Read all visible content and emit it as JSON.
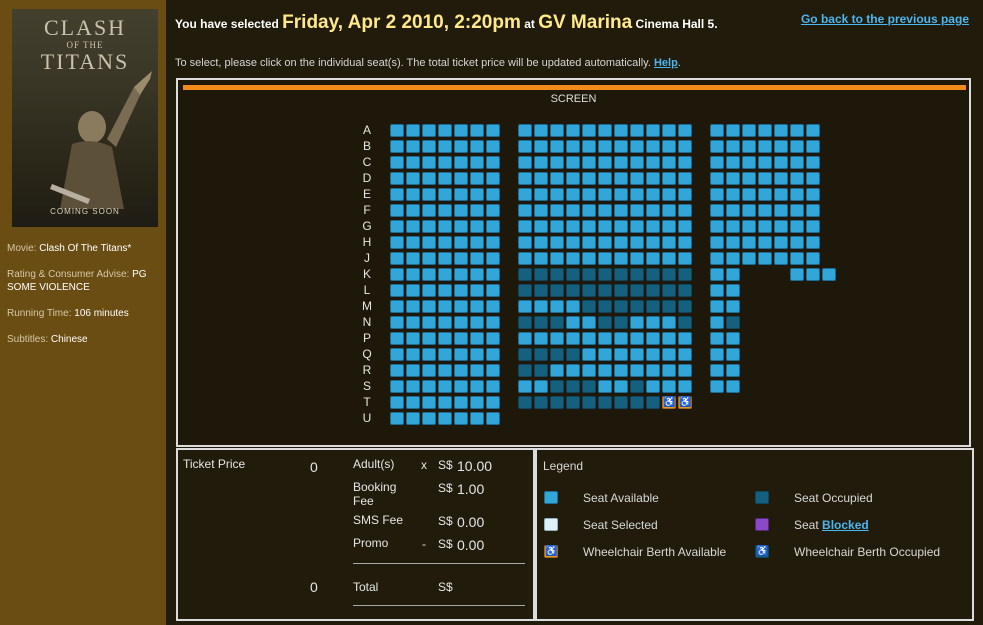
{
  "sidebar": {
    "poster": {
      "title_line1": "CLASH",
      "title_line2": "OF THE",
      "title_line3": "TITANS",
      "caption": "COMING SOON"
    },
    "movie_label": "Movie:",
    "movie_value": "Clash Of The Titans*",
    "rating_label": "Rating & Consumer Advise:",
    "rating_value": "PG",
    "rating_advice": "SOME VIOLENCE",
    "runtime_label": "Running Time:",
    "runtime_value": "106 minutes",
    "subtitles_label": "Subtitles:",
    "subtitles_value": "Chinese"
  },
  "header": {
    "selected_prefix": "You have selected",
    "datetime": "Friday, Apr 2 2010, 2:20pm",
    "at": "at",
    "venue": "GV Marina",
    "hall": "Cinema Hall 5.",
    "back_link": "Go back to the previous page",
    "instruction": "To select, please click on the individual seat(s). The total ticket price will be updated automatically.",
    "help_link": "Help",
    "period": "."
  },
  "seatmap": {
    "screen_label": "SCREEN",
    "rows": [
      {
        "label": "A",
        "seats": "AAAAAAA.AAAAAAAAAAA.AAAAAAA"
      },
      {
        "label": "B",
        "seats": "AAAAAAA.AAAAAAAAAAA.AAAAAAA"
      },
      {
        "label": "C",
        "seats": "AAAAAAA.AAAAAAAAAAA.AAAAAAA"
      },
      {
        "label": "D",
        "seats": "AAAAAAA.AAAAAAAAAAA.AAAAAAA"
      },
      {
        "label": "E",
        "seats": "AAAAAAA.AAAAAAAAAAA.AAAAAAA"
      },
      {
        "label": "F",
        "seats": "AAAAAAA.AAAAAAAAAAA.AAAAAAA"
      },
      {
        "label": "G",
        "seats": "AAAAAAA.AAAAAAAAAAA.AAAAAAA"
      },
      {
        "label": "H",
        "seats": "AAAAAAA.AAAAAAAAAAA.AAAAAAA"
      },
      {
        "label": "J",
        "seats": "AAAAAAA.AAAAAAAAAAA.AAAAAAA"
      },
      {
        "label": "K",
        "seats": "AAAAAAA.OOOOOOOOOOO.AA...AAA"
      },
      {
        "label": "L",
        "seats": "AAAAAAA.OOOOOOOOOOO.AA"
      },
      {
        "label": "M",
        "seats": "AAAAAAA.AAAAOOOOOOO.AA"
      },
      {
        "label": "N",
        "seats": "AAAAAAA.OOOAAOOAAAO.AO"
      },
      {
        "label": "P",
        "seats": "AAAAAAA.AAAAAAAAAAA.AA"
      },
      {
        "label": "Q",
        "seats": "AAAAAAA.OOOOAAAAAAA.AA"
      },
      {
        "label": "R",
        "seats": "AAAAAAA.OOAAAAAAAAA.AA"
      },
      {
        "label": "S",
        "seats": "AAAAAAA.AAOOOAAOAAA.AA"
      },
      {
        "label": "T",
        "seats": "AAAAAAA.OOOOOOOOOWW"
      },
      {
        "label": "U",
        "seats": "AAAAAAA"
      }
    ]
  },
  "price": {
    "ticket_price_label": "Ticket Price",
    "qty": "0",
    "adult_label": "Adult(s)",
    "x": "x",
    "adult_currency": "S$",
    "adult_price": "10.00",
    "booking_label": "Booking Fee",
    "booking_currency": "S$",
    "booking_price": "1.00",
    "sms_label": "SMS Fee",
    "sms_currency": "S$",
    "sms_price": "0.00",
    "promo_label": "Promo",
    "promo_sign": "-",
    "promo_currency": "S$",
    "promo_price": "0.00",
    "total_qty": "0",
    "total_label": "Total",
    "total_currency": "S$"
  },
  "legend": {
    "title": "Legend",
    "available": "Seat Available",
    "occupied": "Seat Occupied",
    "selected": "Seat Selected",
    "blocked_prefix": "Seat",
    "blocked_link": "Blocked",
    "wheel_available": "Wheelchair Berth Available",
    "wheel_occupied": "Wheelchair Berth Occupied",
    "wheel_glyph": "♿"
  }
}
